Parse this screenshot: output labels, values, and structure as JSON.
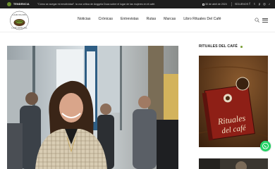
{
  "topbar": {
    "trend_label": "TENDENCIA",
    "ticker": "\"Cómo se avegar mi emotividad\". la voz crítica de Anggela Duca sobre el lugar de las mujeres en el café.",
    "date": "30 de abril de 2024",
    "follow_label": "SÍGUENOS",
    "social_icons": [
      "facebook-icon",
      "twitter-icon",
      "pinterest-icon",
      "instagram-icon",
      "tiktok-icon"
    ]
  },
  "header": {
    "logo_alt": "La Ruta del Café Especial",
    "nav": [
      "Noticias",
      "Crónicas",
      "Entrevistas",
      "Rutas",
      "Marcas",
      "Libro Rituales Del Café"
    ]
  },
  "sidebar": {
    "title": "RITUALES DEL CAFÉ",
    "book_title_line1": "Rituales",
    "book_title_line2": "del café"
  },
  "colors": {
    "accent": "#7da23a",
    "topbar_bg": "#1d1d1d",
    "whatsapp": "#25d366"
  }
}
